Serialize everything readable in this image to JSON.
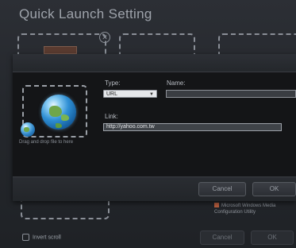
{
  "background": {
    "title": "Quick Launch Setting",
    "invert_scroll_label": "Invert scroll",
    "option_text": "Microsoft Windows Media Configuration Utility",
    "cancel_label": "Cancel",
    "ok_label": "OK"
  },
  "dialog": {
    "drop_hint": "Drag and drop file to here",
    "type_label": "Type:",
    "type_value": "URL",
    "name_label": "Name:",
    "name_value": "",
    "link_label": "Link:",
    "link_value": "http://yahoo.com.tw",
    "cancel_label": "Cancel",
    "ok_label": "OK"
  }
}
